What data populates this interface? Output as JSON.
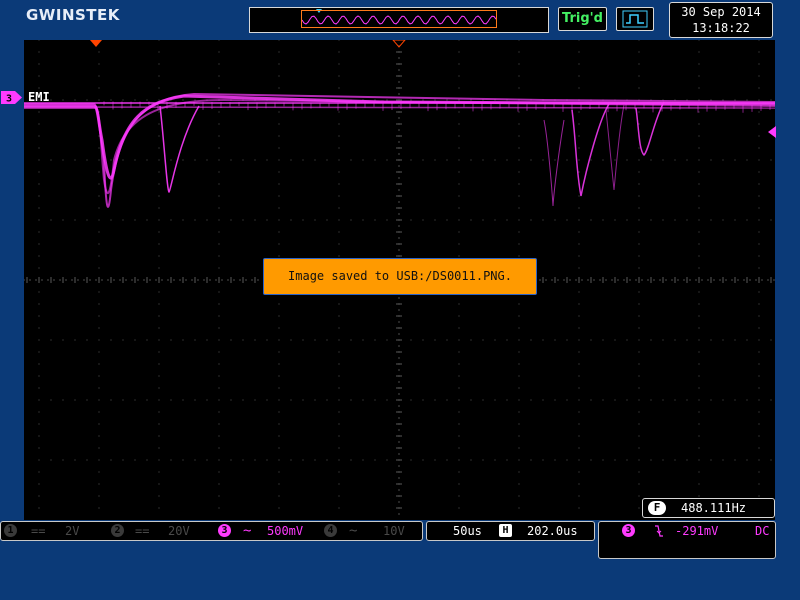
{
  "brand": "GWINSTEK",
  "status": {
    "trigger_state": "Trig'd"
  },
  "datetime": {
    "date": "30 Sep 2014",
    "time": "13:18:22"
  },
  "channel_label": {
    "number": "3",
    "name": "EMI"
  },
  "message": "Image saved to USB:/DS0011.PNG.",
  "frequency": {
    "icon_letter": "F",
    "value": "488.111Hz"
  },
  "channels": [
    {
      "number": "1",
      "coupling": "==",
      "scale": "2V",
      "active": false
    },
    {
      "number": "2",
      "coupling": "==",
      "scale": "20V",
      "active": false
    },
    {
      "number": "3",
      "coupling": "~",
      "scale": "500mV",
      "active": true
    },
    {
      "number": "4",
      "coupling": "~",
      "scale": "10V",
      "active": false
    }
  ],
  "timebase": {
    "scale": "50us",
    "delay_icon": "H",
    "delay": "202.0us"
  },
  "trigger": {
    "source": "3",
    "slope_icon": "falling-edge-icon",
    "level": "-291mV",
    "coupling": "DC"
  },
  "colors": {
    "background": "#0b3a78",
    "trace_ch3": "#ff3bff",
    "message_bg": "#ff9a00",
    "trig_state": "#44f063",
    "marker": "#ff4400",
    "grid": "#5a5a5a"
  },
  "icons": {
    "acquire": "square-wave-icon",
    "trigger_position": "triangle-marker-icon",
    "trigger_level": "left-arrow-marker-icon"
  }
}
